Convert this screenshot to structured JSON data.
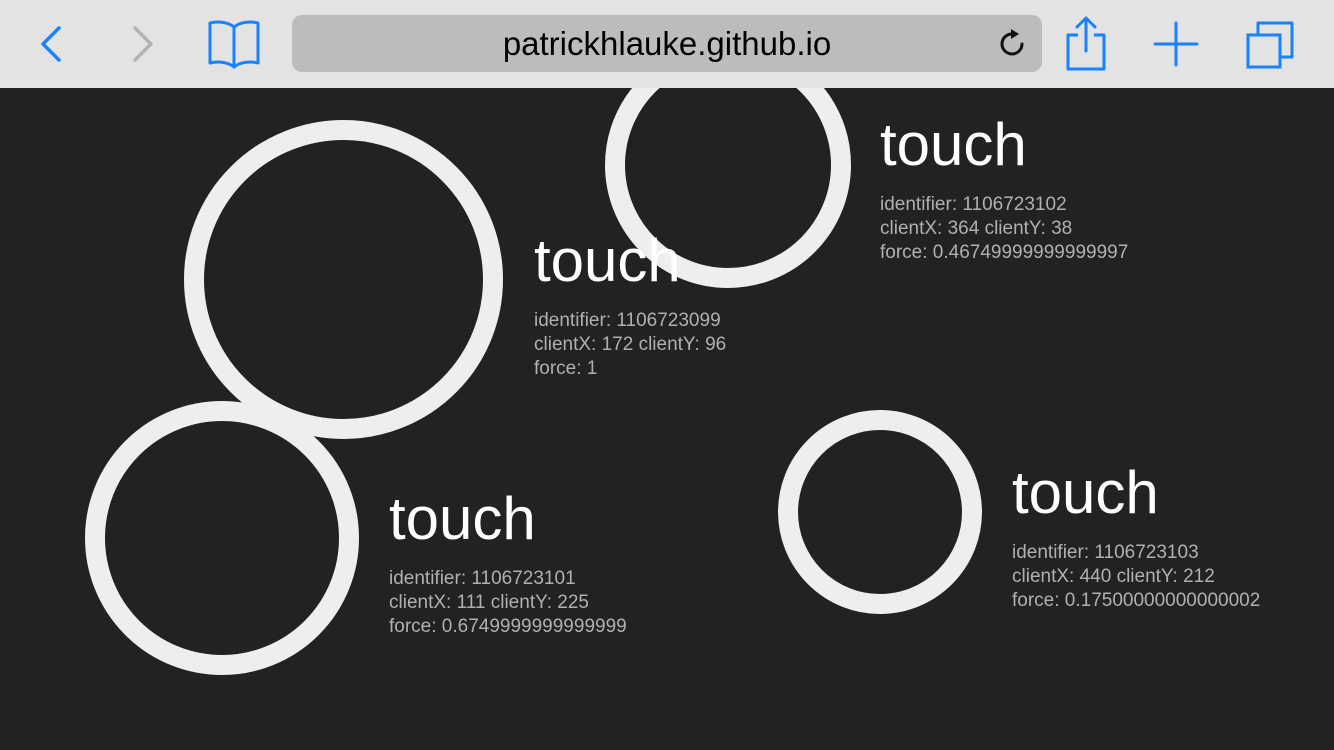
{
  "browser": {
    "url": "patrickhlauke.github.io",
    "icons": {
      "back": "chevron-left-icon",
      "forward": "chevron-right-icon",
      "bookmarks": "open-book-icon",
      "reload": "reload-icon",
      "share": "share-icon",
      "new_tab": "plus-icon",
      "tabs": "tabs-icon"
    },
    "accent_color": "#1a82fb",
    "disabled_color": "#b3b3b3"
  },
  "page": {
    "background": "#222222",
    "ring_color": "#eeeeee",
    "touches": [
      {
        "label": "touch",
        "identifier": "identifier: 1106723102",
        "client": "clientX: 364 clientY: 38",
        "force": "force: 0.46749999999999997"
      },
      {
        "label": "touch",
        "identifier": "identifier: 1106723099",
        "client": "clientX: 172 clientY: 96",
        "force": "force: 1"
      },
      {
        "label": "touch",
        "identifier": "identifier: 1106723101",
        "client": "clientX: 111 clientY: 225",
        "force": "force: 0.6749999999999999"
      },
      {
        "label": "touch",
        "identifier": "identifier: 1106723103",
        "client": "clientX: 440 clientY: 212",
        "force": "force: 0.17500000000000002"
      }
    ]
  }
}
